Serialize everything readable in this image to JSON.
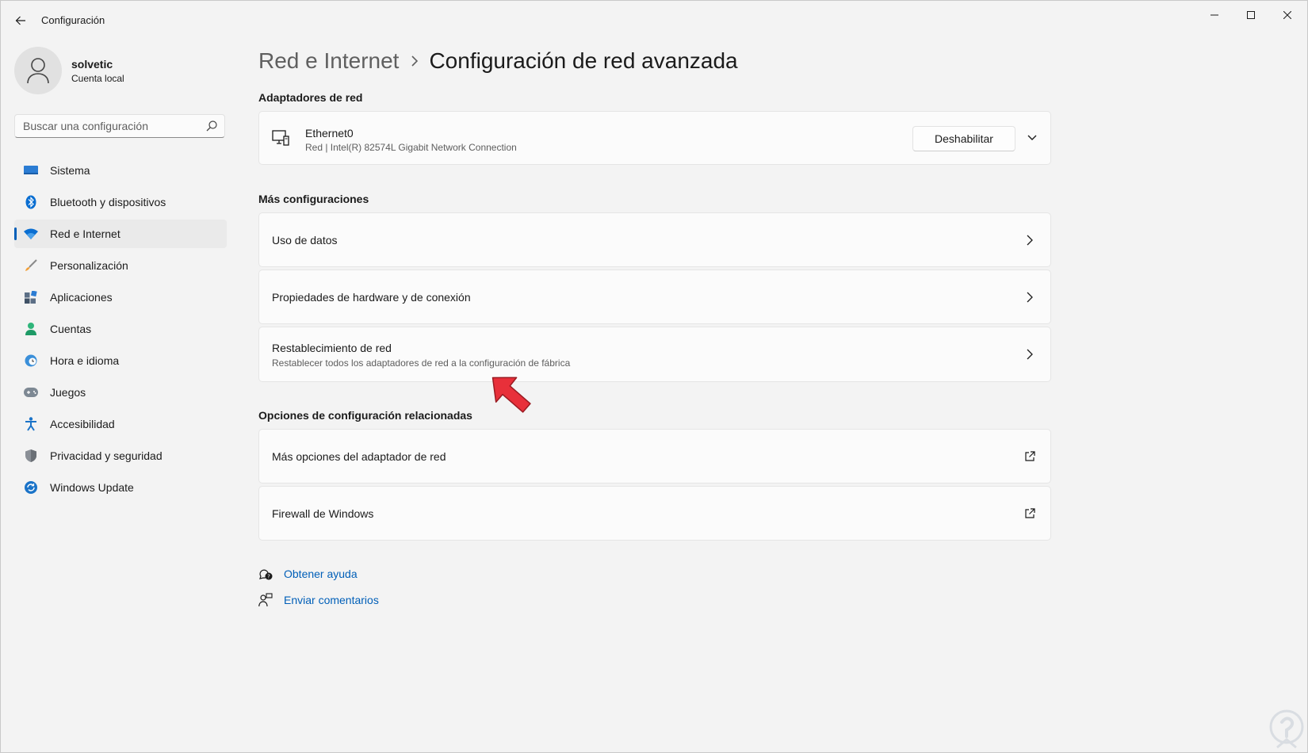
{
  "window": {
    "title": "Configuración"
  },
  "profile": {
    "name": "solvetic",
    "account_type": "Cuenta local"
  },
  "search": {
    "placeholder": "Buscar una configuración"
  },
  "sidebar": {
    "items": [
      {
        "label": "Sistema",
        "icon": "system-icon",
        "active": false
      },
      {
        "label": "Bluetooth y dispositivos",
        "icon": "bluetooth-icon",
        "active": false
      },
      {
        "label": "Red e Internet",
        "icon": "wifi-icon",
        "active": true
      },
      {
        "label": "Personalización",
        "icon": "brush-icon",
        "active": false
      },
      {
        "label": "Aplicaciones",
        "icon": "apps-icon",
        "active": false
      },
      {
        "label": "Cuentas",
        "icon": "person-icon",
        "active": false
      },
      {
        "label": "Hora e idioma",
        "icon": "globe-clock-icon",
        "active": false
      },
      {
        "label": "Juegos",
        "icon": "gamepad-icon",
        "active": false
      },
      {
        "label": "Accesibilidad",
        "icon": "accessibility-icon",
        "active": false
      },
      {
        "label": "Privacidad y seguridad",
        "icon": "shield-icon",
        "active": false
      },
      {
        "label": "Windows Update",
        "icon": "update-icon",
        "active": false
      }
    ]
  },
  "breadcrumb": {
    "parent": "Red e Internet",
    "current": "Configuración de red avanzada"
  },
  "adapters": {
    "section_title": "Adaptadores de red",
    "items": [
      {
        "name": "Ethernet0",
        "description": "Red | Intel(R) 82574L Gigabit Network Connection",
        "button_label": "Deshabilitar"
      }
    ]
  },
  "more_settings": {
    "section_title": "Más configuraciones",
    "items": [
      {
        "label": "Uso de datos",
        "description": ""
      },
      {
        "label": "Propiedades de hardware y de conexión",
        "description": ""
      },
      {
        "label": "Restablecimiento de red",
        "description": "Restablecer todos los adaptadores de red a la configuración de fábrica"
      }
    ]
  },
  "related": {
    "section_title": "Opciones de configuración relacionadas",
    "items": [
      {
        "label": "Más opciones del adaptador de red"
      },
      {
        "label": "Firewall de Windows"
      }
    ]
  },
  "help": {
    "get_help": "Obtener ayuda",
    "feedback": "Enviar comentarios"
  },
  "colors": {
    "accent": "#005fb8",
    "pointer": "#e8303a",
    "background": "#f3f3f3",
    "card": "#fbfbfb"
  }
}
